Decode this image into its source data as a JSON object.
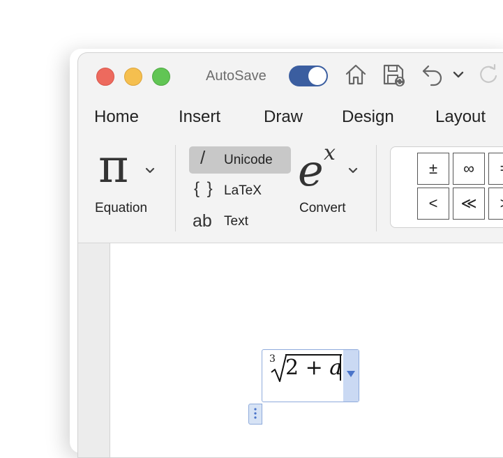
{
  "titlebar": {
    "autosave_label": "AutoSave",
    "autosave_state": "on"
  },
  "icons": {
    "home": "home-icon",
    "save": "save-icon",
    "undo": "undo-icon",
    "undo_menu": "chevron-down-icon",
    "redo": "redo-icon"
  },
  "tabs": [
    "Home",
    "Insert",
    "Draw",
    "Design",
    "Layout"
  ],
  "ribbon": {
    "equation": {
      "symbol": "π",
      "label": "Equation"
    },
    "formats": [
      {
        "icon": "/",
        "label": "Unicode",
        "selected": true
      },
      {
        "icon": "{ }",
        "label": "LaTeX",
        "selected": false
      },
      {
        "icon": "ab",
        "label": "Text",
        "selected": false
      }
    ],
    "convert": {
      "symbol_base": "e",
      "symbol_exp": "x",
      "label": "Convert"
    },
    "symbols": [
      [
        "±",
        "∞",
        "="
      ],
      [
        "<",
        "≪",
        ">"
      ]
    ]
  },
  "equation": {
    "root_index": "3",
    "radicand_number": "2 + ",
    "radicand_variable": "a"
  },
  "colors": {
    "accent": "#3b5ea0",
    "selection": "#cad9f3",
    "close": "#ed6a5e",
    "minimize": "#f5bf4f",
    "maximize": "#61c554"
  }
}
